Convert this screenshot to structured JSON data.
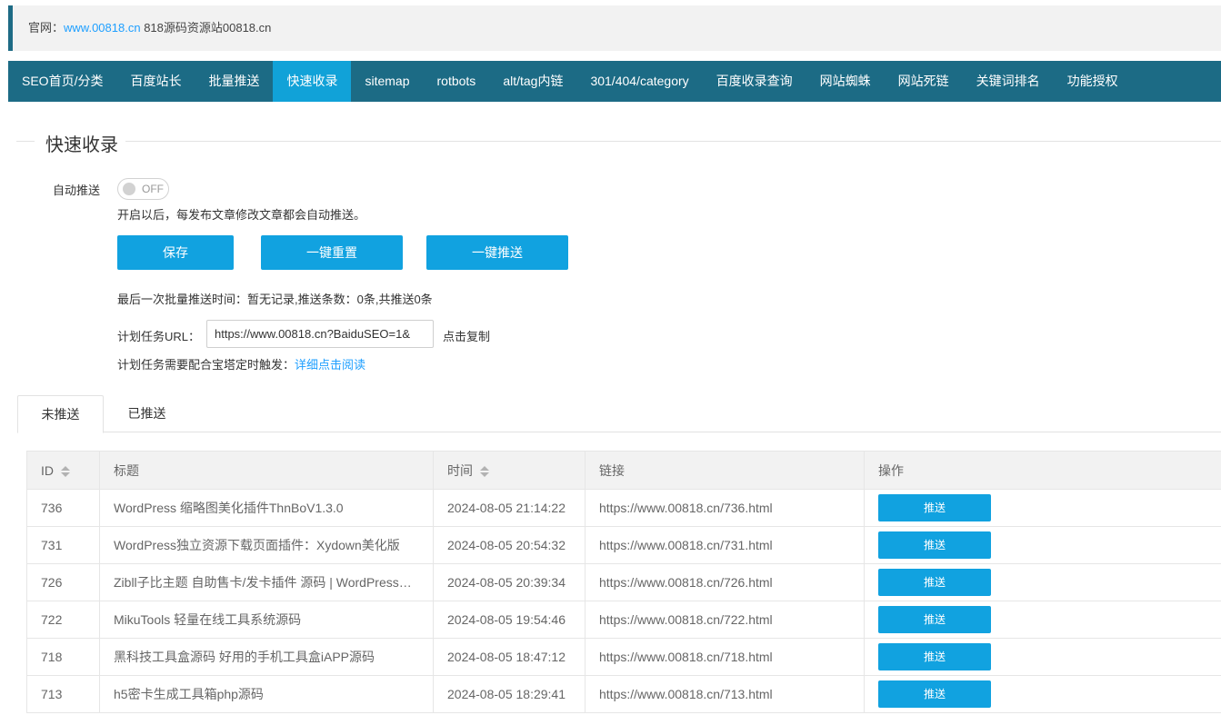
{
  "notice": {
    "label": "官网：",
    "link": "www.00818.cn",
    "suffix": " 818源码资源站00818.cn"
  },
  "nav": {
    "items": [
      {
        "label": "SEO首页/分类"
      },
      {
        "label": "百度站长"
      },
      {
        "label": "批量推送"
      },
      {
        "label": "快速收录",
        "active": true
      },
      {
        "label": "sitemap"
      },
      {
        "label": "rotbots"
      },
      {
        "label": "alt/tag内链"
      },
      {
        "label": "301/404/category"
      },
      {
        "label": "百度收录查询"
      },
      {
        "label": "网站蜘蛛"
      },
      {
        "label": "网站死链"
      },
      {
        "label": "关键词排名"
      },
      {
        "label": "功能授权"
      }
    ]
  },
  "section": {
    "title": "快速收录"
  },
  "auto_push": {
    "label": "自动推送",
    "switch_text": "OFF",
    "hint": "开启以后，每发布文章修改文章都会自动推送。"
  },
  "buttons": {
    "save": "保存",
    "reset": "一键重置",
    "push": "一键推送"
  },
  "last_push": "最后一次批量推送时间：暂无记录,推送条数：0条,共推送0条",
  "cron": {
    "label": "计划任务URL：",
    "value": "https://www.00818.cn?BaiduSEO=1&",
    "copy": "点击复制",
    "note": "计划任务需要配合宝塔定时触发：",
    "note_link": "详细点击阅读"
  },
  "tabs": [
    {
      "label": "未推送"
    },
    {
      "label": "已推送"
    }
  ],
  "table": {
    "headers": {
      "id": "ID",
      "title": "标题",
      "time": "时间",
      "link": "链接",
      "action": "操作"
    },
    "rows": [
      {
        "id": "736",
        "title": "WordPress 缩略图美化插件ThnBoV1.3.0",
        "time": "2024-08-05 21:14:22",
        "link": "https://www.00818.cn/736.html",
        "action": "推送"
      },
      {
        "id": "731",
        "title": "WordPress独立资源下载页面插件：Xydown美化版",
        "time": "2024-08-05 20:54:32",
        "link": "https://www.00818.cn/731.html",
        "action": "推送"
      },
      {
        "id": "726",
        "title": "Zibll子比主题 自助售卡/发卡插件 源码 | WordPress…",
        "time": "2024-08-05 20:39:34",
        "link": "https://www.00818.cn/726.html",
        "action": "推送"
      },
      {
        "id": "722",
        "title": "MikuTools 轻量在线工具系统源码",
        "time": "2024-08-05 19:54:46",
        "link": "https://www.00818.cn/722.html",
        "action": "推送"
      },
      {
        "id": "718",
        "title": "黑科技工具盒源码 好用的手机工具盒iAPP源码",
        "time": "2024-08-05 18:47:12",
        "link": "https://www.00818.cn/718.html",
        "action": "推送"
      },
      {
        "id": "713",
        "title": "h5密卡生成工具箱php源码",
        "time": "2024-08-05 18:29:41",
        "link": "https://www.00818.cn/713.html",
        "action": "推送"
      }
    ]
  },
  "colors": {
    "nav_bg": "#1c6b85",
    "nav_active": "#11a2d8",
    "button": "#11a2e0",
    "link": "#1e9fff"
  }
}
